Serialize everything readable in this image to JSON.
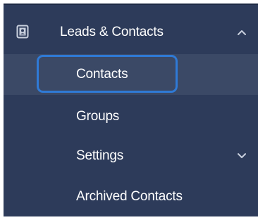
{
  "nav": {
    "parent": {
      "label": "Leads & Contacts",
      "icon": "contact-book-icon",
      "expanded": true,
      "chevron": "chevron-up-icon"
    },
    "items": [
      {
        "label": "Contacts",
        "selected": true,
        "focused": true
      },
      {
        "label": "Groups"
      },
      {
        "label": "Settings",
        "chevron": "chevron-down-icon"
      },
      {
        "label": "Archived Contacts"
      }
    ]
  },
  "colors": {
    "sidebar_bg": "#2d3b5a",
    "selected_row_bg": "#3b4966",
    "focus_ring": "#2f7ad6",
    "text": "#ffffff",
    "chevron": "#c9d0de"
  }
}
